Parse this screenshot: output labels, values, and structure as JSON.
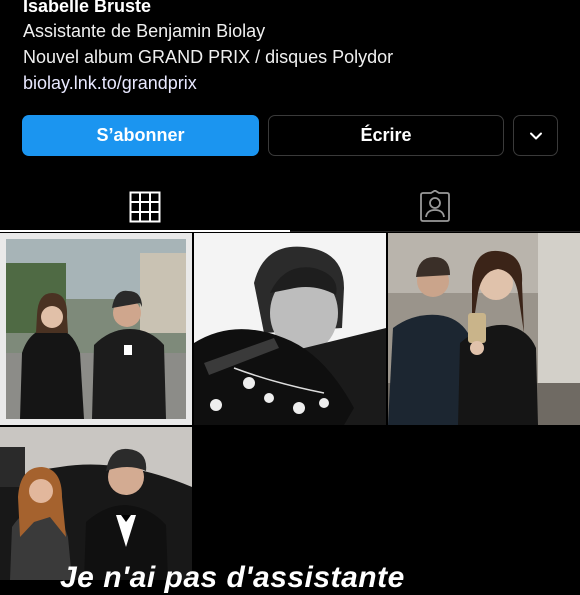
{
  "profile": {
    "name": "Isabelle Bruste",
    "bio_lines": [
      "Assistante de Benjamin Biolay",
      "Nouvel album GRAND PRIX / disques Polydor"
    ],
    "link": "biolay.lnk.to/grandprix"
  },
  "actions": {
    "follow_label": "S’abonner",
    "message_label": "Écrire",
    "more_icon": "chevron-down-icon"
  },
  "tabs": {
    "grid_icon": "grid-icon",
    "tagged_icon": "tagged-person-icon"
  },
  "overlay_text": "Je n'ai pas d'assistante",
  "colors": {
    "accent": "#1b95f0",
    "background": "#000000",
    "border": "#3a3a3a"
  }
}
